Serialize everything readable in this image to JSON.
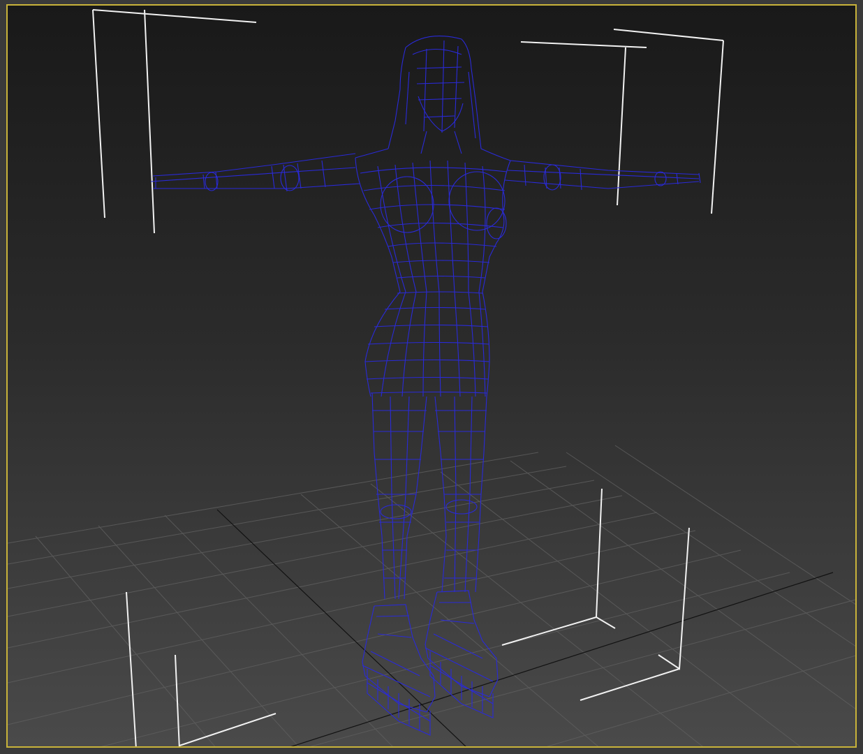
{
  "viewport": {
    "mode": "perspective",
    "shading": "wireframe",
    "active": true
  },
  "colors": {
    "active_border": "#c9b33a",
    "mesh_wire": "#2a2ad8",
    "grid_line": "#5e5e5e",
    "grid_axis": "#111111",
    "bracket": "#f2f2f2"
  },
  "scene": {
    "object": "female-figure-mesh",
    "pose": "t-pose",
    "selected": true
  }
}
